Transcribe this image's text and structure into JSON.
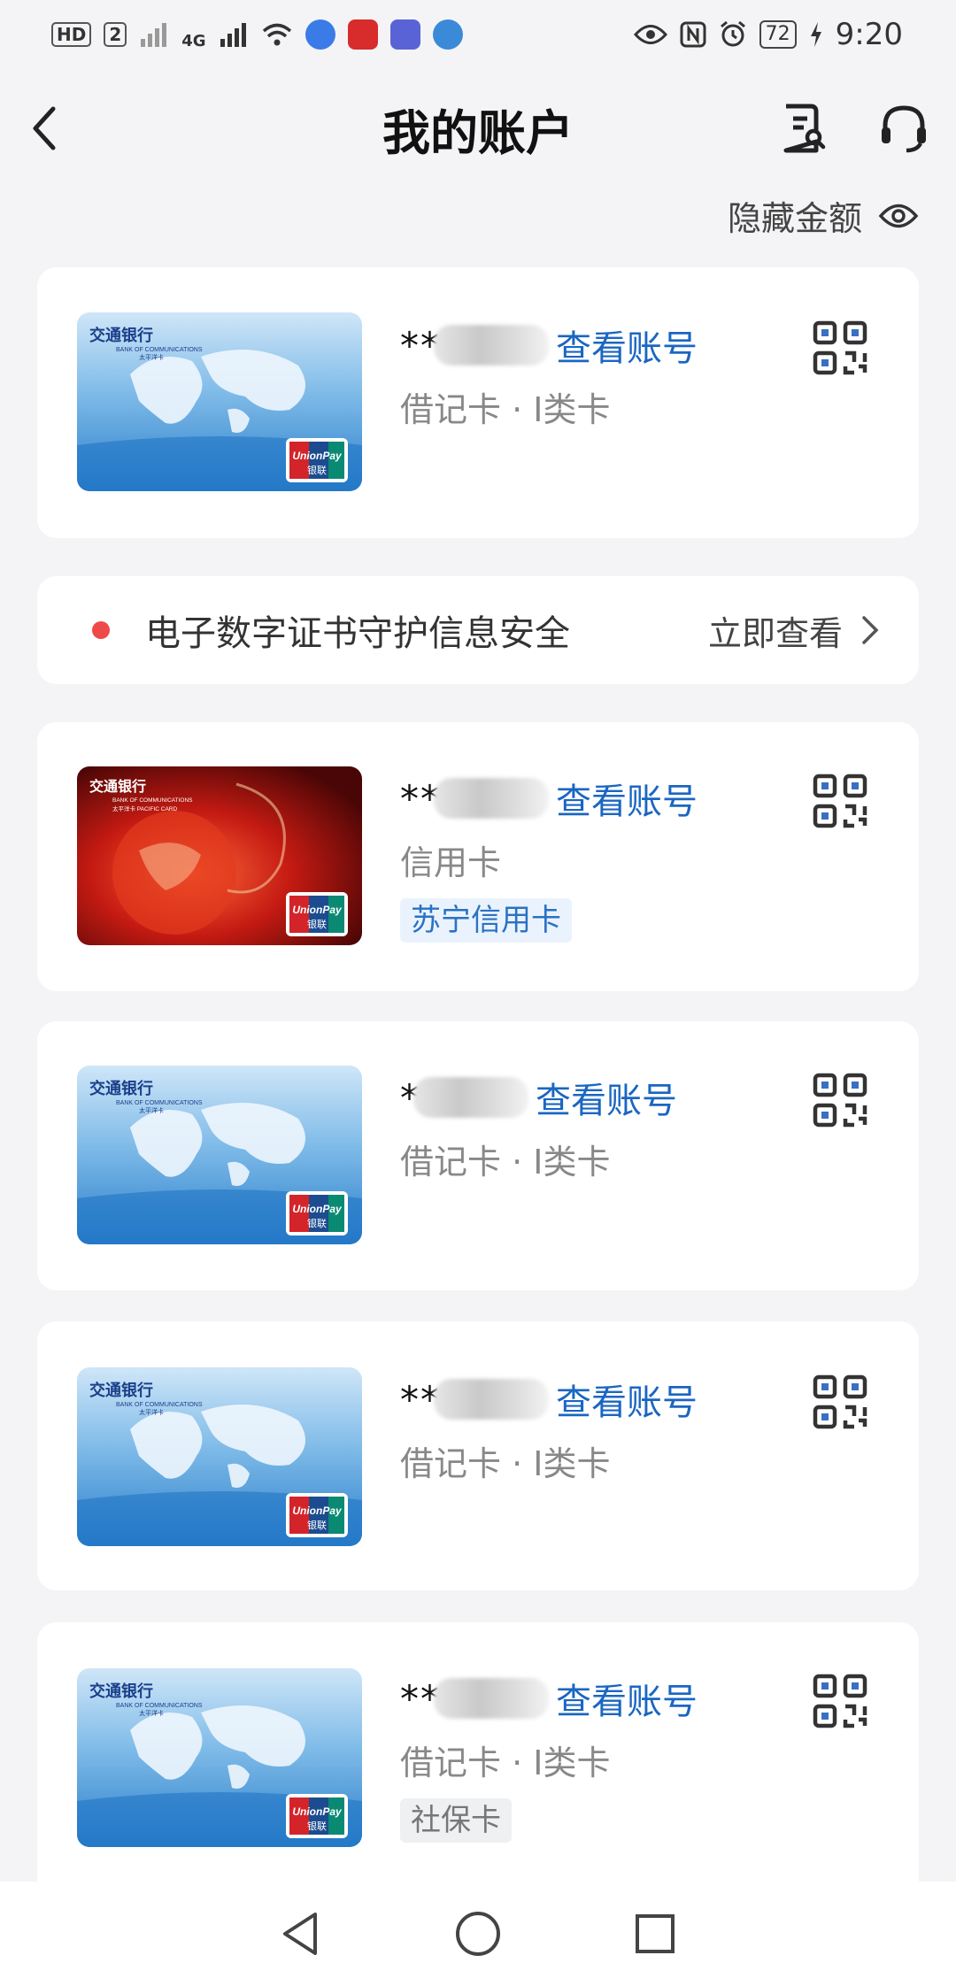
{
  "status_bar": {
    "left_text": [
      "HD",
      "2",
      "4G"
    ],
    "battery": "72",
    "time": "9:20",
    "icons": [
      "wifi-icon",
      "music-app-icon",
      "study-app-icon",
      "edu-app-icon",
      "browser-app-icon",
      "eye-icon",
      "nfc-icon",
      "alarm-icon",
      "charging-icon"
    ]
  },
  "header": {
    "title": "我的账户",
    "icons": [
      "back-icon",
      "document-search-icon",
      "customer-service-icon"
    ]
  },
  "hide_amount": {
    "label": "隐藏金额",
    "icon": "eye-icon"
  },
  "notice": {
    "text": "电子数字证书守护信息安全",
    "action": "立即查看"
  },
  "accounts": [
    {
      "masked": "**",
      "view_label": "查看账号",
      "type": "借记卡 · Ⅰ类卡",
      "tag": "",
      "card_style": "blue"
    },
    {
      "masked": "**",
      "view_label": "查看账号",
      "type": "信用卡",
      "tag": "苏宁信用卡",
      "card_style": "red"
    },
    {
      "masked": "*",
      "view_label": "查看账号",
      "type": "借记卡 · Ⅰ类卡",
      "tag": "",
      "card_style": "blue"
    },
    {
      "masked": "**",
      "view_label": "查看账号",
      "type": "借记卡 · Ⅰ类卡",
      "tag": "",
      "card_style": "blue"
    },
    {
      "masked": "**",
      "view_label": "查看账号",
      "type": "借记卡 · Ⅰ类卡",
      "tag": "社保卡",
      "card_style": "blue"
    }
  ],
  "card_face": {
    "bank_name": "交通银行",
    "bank_english": "BANK OF COMMUNICATIONS",
    "series_blue": "太平洋卡",
    "series_red": "太平洋卡 PACIFIC CARD",
    "unionpay": "UnionPay",
    "unionpay_cn": "银联"
  },
  "colors": {
    "link": "#1a66c2",
    "notice_dot": "#ef4a4a",
    "background": "#f4f4f6"
  },
  "nav_bar": {
    "icons": [
      "back-triangle-icon",
      "home-circle-icon",
      "recents-square-icon"
    ]
  }
}
